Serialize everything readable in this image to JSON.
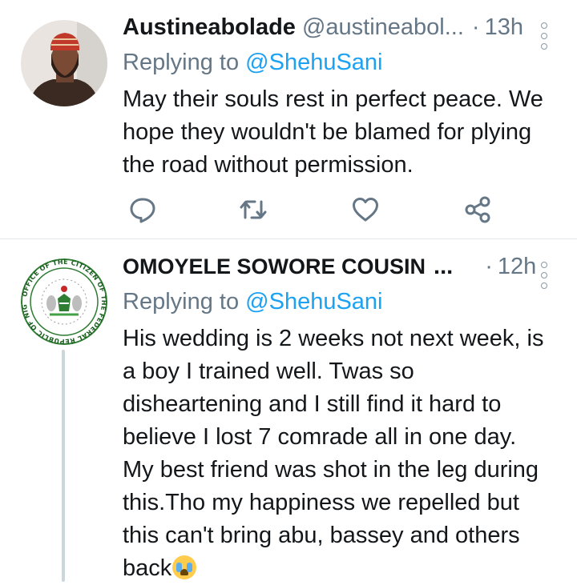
{
  "tweets": [
    {
      "avatar": "avatar-man-in-red-cap",
      "name": "Austineabolade",
      "handle": "@austineabol...",
      "separator": "·",
      "time": "13h",
      "replying_prefix": "Replying to",
      "replying_to": "@ShehuSani",
      "text_lines": [
        "May their souls rest in perfect peace. We",
        "hope they wouldn't be blamed for plying",
        "the road without permission."
      ],
      "actions": [
        "reply-icon",
        "retweet-icon",
        "like-icon",
        "share-icon"
      ]
    },
    {
      "avatar": "seal-office-of-the-citizen",
      "avatar_seal_text": "OFFICE OF THE CITIZEN OF THE FEDERAL REPUBLIC OF NIGERIA",
      "name": "OMOYELE SOWORE COUSIN",
      "name_ellipsis": "...",
      "separator": "·",
      "time": "12h",
      "replying_prefix": "Replying to",
      "replying_to": "@ShehuSani",
      "text_lines": [
        "His wedding is 2 weeks not next week, is",
        "a boy I trained well. Twas so",
        "disheartening and I still find it hard to",
        "believe I lost 7 comrade all in one day.",
        "My best friend was shot in the leg during",
        "this.Tho my happiness we repelled but",
        "this can't bring abu, bassey and others",
        "back"
      ],
      "trailing_emoji": "loudly-crying-face-emoji"
    }
  ],
  "colors": {
    "text": "#14171a",
    "secondary": "#657786",
    "link": "#1da1f2",
    "icon": "#657786",
    "divider": "#e1e8ed"
  }
}
